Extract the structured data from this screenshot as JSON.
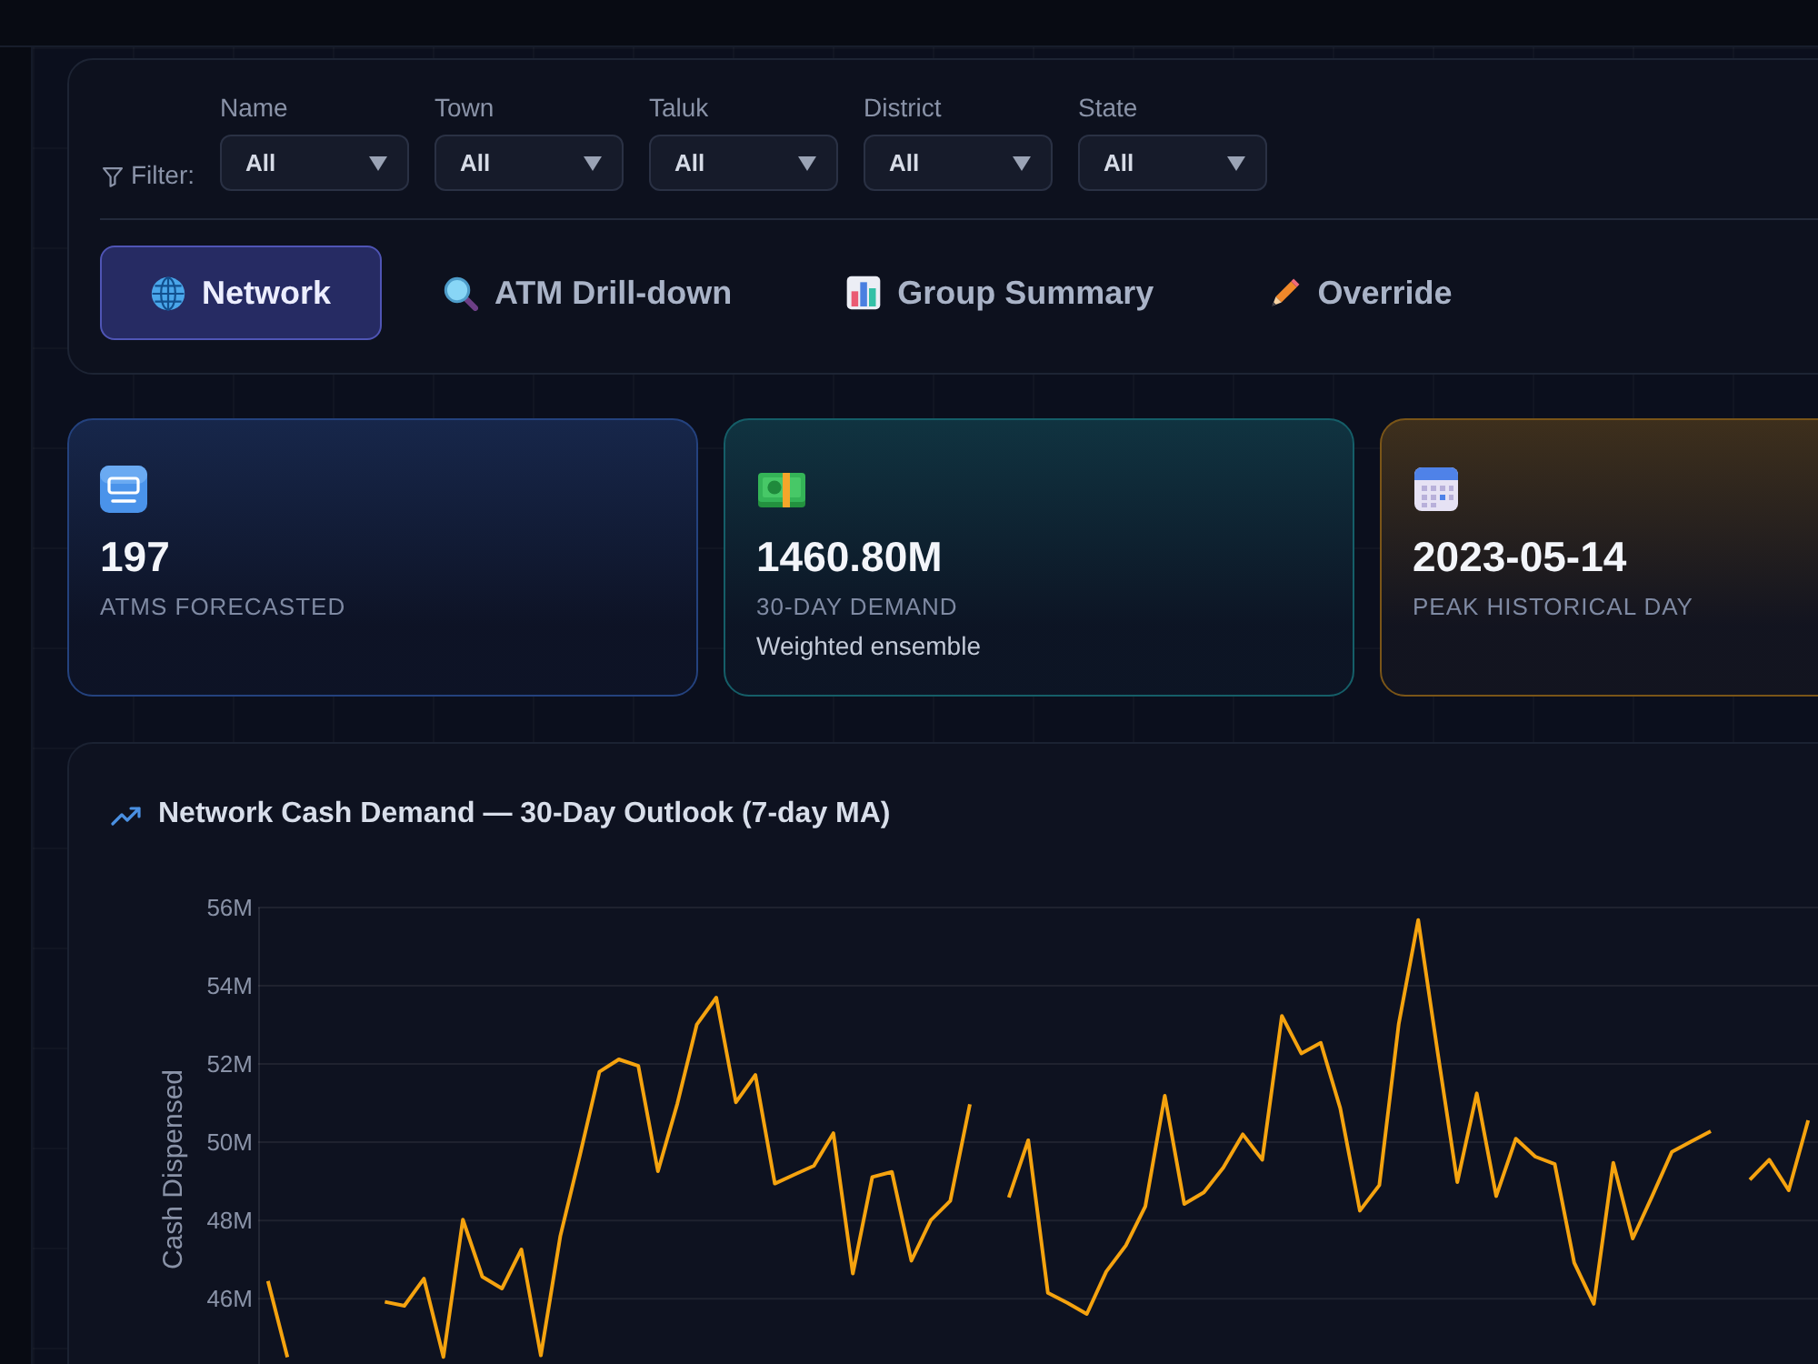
{
  "filter_bar": {
    "label": "Filter:",
    "filters": [
      {
        "label": "Name",
        "value": "All"
      },
      {
        "label": "Town",
        "value": "All"
      },
      {
        "label": "Taluk",
        "value": "All"
      },
      {
        "label": "District",
        "value": "All"
      },
      {
        "label": "State",
        "value": "All"
      }
    ]
  },
  "tabs": [
    {
      "label": "Network",
      "selected": true
    },
    {
      "label": "ATM Drill-down",
      "selected": false
    },
    {
      "label": "Group Summary",
      "selected": false
    },
    {
      "label": "Override",
      "selected": false
    }
  ],
  "stat_cards": [
    {
      "value": "197",
      "label": "ATMS FORECASTED",
      "color": "#24427e"
    },
    {
      "value": "1460.80M",
      "label": "30-DAY DEMAND",
      "note": "Weighted ensemble",
      "color": "#155e68"
    },
    {
      "value": "2023-05-14",
      "label": "PEAK HISTORICAL DAY",
      "color": "#7a5518"
    }
  ],
  "chart_panel": {
    "title": "Network Cash Demand — 30-Day Outlook (7-day MA)",
    "chart_data": [
      {
        "type": "line",
        "ylabel": "Cash Dispensed",
        "ylim": [
          44.33,
          56
        ],
        "yticks": [
          {
            "value": 46,
            "label": "46M"
          },
          {
            "value": 48,
            "label": "48M"
          },
          {
            "value": 50,
            "label": "50M"
          },
          {
            "value": 52,
            "label": "52M"
          },
          {
            "value": 54,
            "label": "54M"
          },
          {
            "value": 56,
            "label": "56M"
          }
        ],
        "tick_labels": "y",
        "grid": true,
        "color": "#f5a30f",
        "values": [
          46.45,
          44.5,
          null,
          null,
          null,
          null,
          45.92,
          45.82,
          46.51,
          44.51,
          48.02,
          46.56,
          46.26,
          47.26,
          44.55,
          47.6,
          49.67,
          51.8,
          52.12,
          51.95,
          49.26,
          50.99,
          53.01,
          53.7,
          51.02,
          51.72,
          48.94,
          49.17,
          49.4,
          50.23,
          46.64,
          49.11,
          49.24,
          46.97,
          48.01,
          48.5,
          50.97,
          null,
          48.59,
          50.05,
          46.15,
          45.89,
          45.61,
          46.69,
          47.36,
          48.36,
          51.19,
          48.42,
          48.72,
          49.35,
          50.2,
          49.55,
          53.23,
          52.27,
          52.54,
          50.87,
          48.25,
          48.9,
          53.03,
          55.68,
          52.26,
          48.98,
          51.25,
          48.62,
          50.09,
          49.63,
          49.44,
          46.92,
          45.87,
          49.47,
          47.54,
          48.62,
          49.75,
          50.02,
          50.28,
          null,
          49.04,
          49.55,
          48.77,
          50.56
        ]
      }
    ]
  }
}
